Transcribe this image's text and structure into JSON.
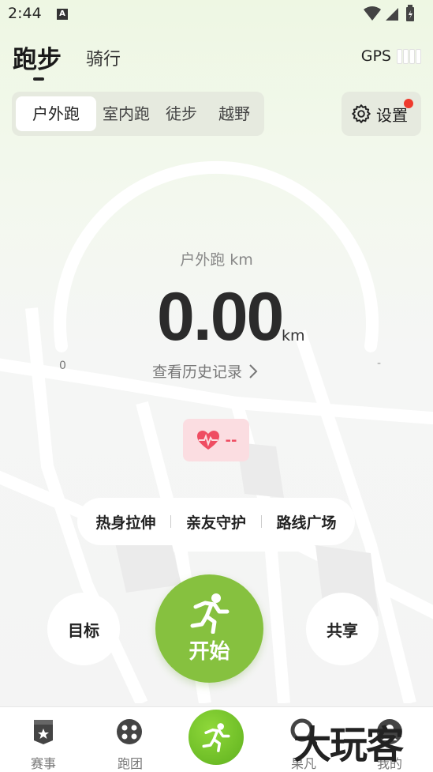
{
  "status_bar": {
    "time": "2:44",
    "notification_badge": "A"
  },
  "header": {
    "main_tab": "跑步",
    "secondary_tab": "骑行",
    "gps_label": "GPS"
  },
  "modes": {
    "items": [
      "户外跑",
      "室内跑",
      "徒步",
      "越野"
    ],
    "active_index": 0
  },
  "settings": {
    "label": "设置"
  },
  "gauge": {
    "label": "户外跑  km",
    "value": "0.00",
    "unit": "km",
    "min": "0",
    "max": "-",
    "history_link": "查看历史记录"
  },
  "heart_rate": {
    "value": "--"
  },
  "quick_links": [
    "热身拉伸",
    "亲友守护",
    "路线广场"
  ],
  "actions": {
    "goal": "目标",
    "start": "开始",
    "share": "共享"
  },
  "bottom_nav": {
    "items": [
      {
        "label": "赛事",
        "icon": "medal-icon"
      },
      {
        "label": "跑团",
        "icon": "group-icon"
      },
      {
        "label": "",
        "icon": "run-icon"
      },
      {
        "label": "果凡",
        "icon": "search-icon"
      },
      {
        "label": "我的",
        "icon": "profile-icon"
      }
    ]
  },
  "watermark": "大玩客",
  "colors": {
    "accent": "#86c13f",
    "heart": "#ef4d62",
    "badge": "#ef3b2d"
  }
}
